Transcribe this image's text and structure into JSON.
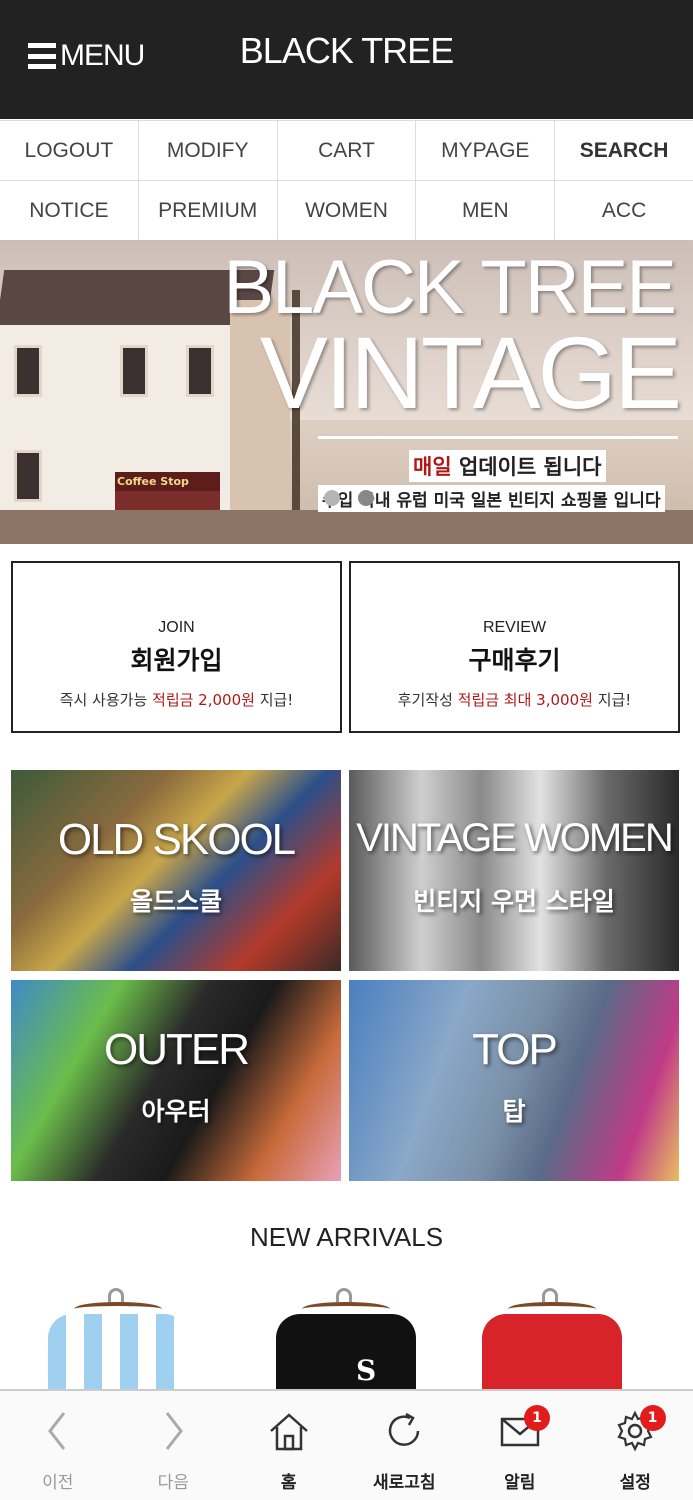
{
  "header": {
    "menu_label": "MENU",
    "title": "BLACK TREE"
  },
  "nav": {
    "row1": [
      "LOGOUT",
      "MODIFY",
      "CART",
      "MYPAGE",
      "SEARCH"
    ],
    "row2": [
      "NOTICE",
      "PREMIUM",
      "WOMEN",
      "MEN",
      "ACC"
    ]
  },
  "hero": {
    "title_line1": "BLACK TREE",
    "title_line2": "VINTAGE",
    "subtitle_highlight": "매일",
    "subtitle_rest": " 업데이트 됩니다",
    "tagline": "수입 국내 유럽 미국 일본 빈티지 쇼핑몰 입니다",
    "sign_text": "Coffee Stop"
  },
  "promos": [
    {
      "en": "JOIN",
      "ko": "회원가입",
      "desc_pre": "즉시 사용가능 ",
      "desc_red": "적립금 2,000원",
      "desc_post": " 지급!"
    },
    {
      "en": "REVIEW",
      "ko": "구매후기",
      "desc_pre": "후기작성 ",
      "desc_red": "적립금 최대 3,000원",
      "desc_post": " 지급!"
    }
  ],
  "categories": [
    {
      "en": "OLD SKOOL",
      "ko": "올드스쿨"
    },
    {
      "en": "VINTAGE WOMEN",
      "ko": "빈티지 우먼 스타일"
    },
    {
      "en": "OUTER",
      "ko": "아우터"
    },
    {
      "en": "TOP",
      "ko": "탑"
    }
  ],
  "new_arrivals": {
    "title": "NEW ARRIVALS",
    "products": [
      {
        "icon": "argentina-jersey-image",
        "logo": ""
      },
      {
        "icon": "black-tshirt-image",
        "logo": "S"
      },
      {
        "icon": "liverpool-jersey-image",
        "logo": ""
      }
    ]
  },
  "bottom_bar": {
    "items": [
      {
        "label": "이전",
        "icon": "back-arrow-icon",
        "badge": ""
      },
      {
        "label": "다음",
        "icon": "forward-arrow-icon",
        "badge": ""
      },
      {
        "label": "홈",
        "icon": "home-icon",
        "badge": ""
      },
      {
        "label": "새로고침",
        "icon": "refresh-icon",
        "badge": ""
      },
      {
        "label": "알림",
        "icon": "mail-icon",
        "badge": "1"
      },
      {
        "label": "설정",
        "icon": "gear-icon",
        "badge": "1"
      }
    ]
  },
  "colors": {
    "header_bg": "#222222",
    "accent_red": "#b01818",
    "badge_red": "#e21b1b"
  }
}
